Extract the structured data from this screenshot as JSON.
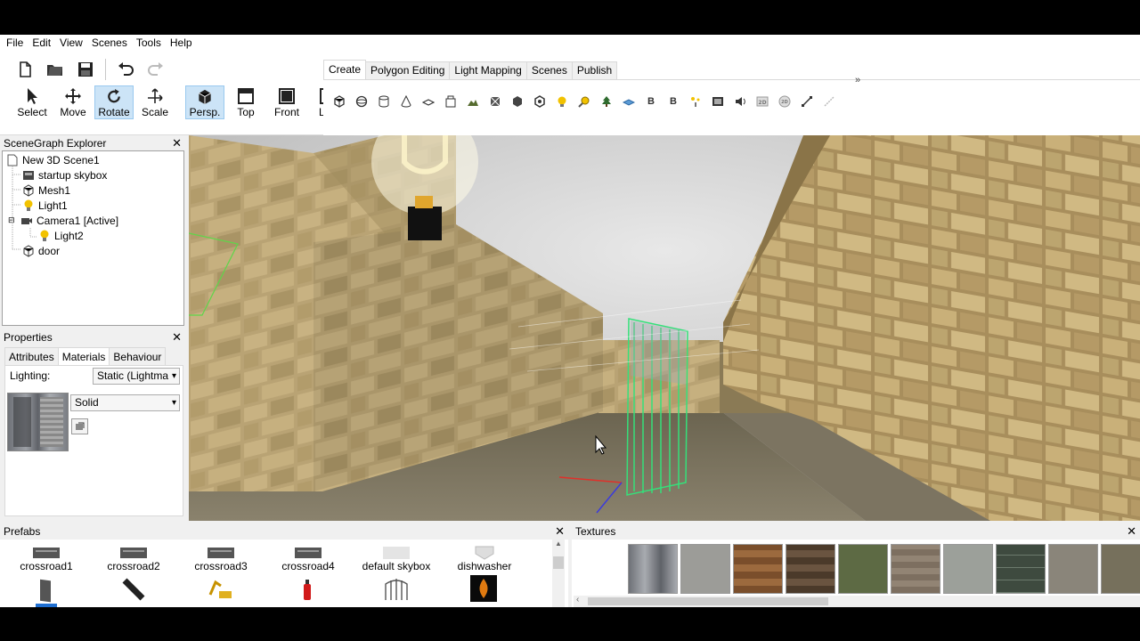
{
  "menu": [
    "File",
    "Edit",
    "View",
    "Scenes",
    "Tools",
    "Help"
  ],
  "toolbar": {
    "file_buttons": [
      "new-file-icon",
      "open-folder-icon",
      "save-icon",
      "undo-icon",
      "redo-icon"
    ],
    "tools": [
      {
        "id": "select",
        "label": "Select",
        "icon": "cursor-arrow-icon",
        "active": false
      },
      {
        "id": "move",
        "label": "Move",
        "icon": "move-arrows-icon",
        "active": false
      },
      {
        "id": "rotate",
        "label": "Rotate",
        "icon": "rotate-icon",
        "active": true
      },
      {
        "id": "scale",
        "label": "Scale",
        "icon": "scale-icon",
        "active": false
      }
    ],
    "views": [
      {
        "id": "persp",
        "label": "Persp.",
        "icon": "perspective-view-icon",
        "active": true
      },
      {
        "id": "top",
        "label": "Top",
        "icon": "top-view-icon",
        "active": false
      },
      {
        "id": "front",
        "label": "Front",
        "icon": "front-view-icon",
        "active": false
      },
      {
        "id": "left",
        "label": "Left",
        "icon": "left-view-icon",
        "active": false
      }
    ]
  },
  "ribbon": {
    "tabs": [
      "Create",
      "Polygon Editing",
      "Light Mapping",
      "Scenes",
      "Publish"
    ],
    "active_tab": "Create",
    "overflow": "»",
    "create_icons": [
      "cube-icon",
      "sphere-icon",
      "cylinder-icon",
      "cone-icon",
      "plane-icon",
      "building-icon",
      "terrain-icon",
      "billboard-icon",
      "mesh-icon",
      "prefab-icon",
      "light-icon",
      "path-icon",
      "tree-icon",
      "water-icon",
      "behaviour-b-icon",
      "behaviour-b2-icon",
      "particle-icon",
      "image-icon",
      "sound-icon",
      "2d-overlay-icon",
      "2d-button-icon",
      "line-icon",
      "path-line-icon"
    ]
  },
  "scenegraph": {
    "title": "SceneGraph Explorer",
    "items": [
      {
        "label": "New 3D Scene1",
        "icon": "document-icon"
      },
      {
        "label": "startup skybox",
        "icon": "skybox-icon"
      },
      {
        "label": "Mesh1",
        "icon": "mesh-icon"
      },
      {
        "label": "Light1",
        "icon": "light-bulb-icon"
      },
      {
        "label": "Camera1 [Active]",
        "icon": "camera-icon"
      },
      {
        "label": "Light2",
        "icon": "light-bulb-icon"
      },
      {
        "label": "door",
        "icon": "mesh-icon"
      }
    ]
  },
  "properties": {
    "title": "Properties",
    "tabs": [
      "Attributes",
      "Materials",
      "Behaviour"
    ],
    "active_tab": "Materials",
    "lighting_label": "Lighting:",
    "lighting_value": "Static (Lightma",
    "material_mode": "Solid"
  },
  "prefabs": {
    "title": "Prefabs",
    "row1": [
      "crossroad1",
      "crossroad2",
      "crossroad3",
      "crossroad4",
      "default skybox",
      "dishwasher"
    ]
  },
  "textures": {
    "title": "Textures",
    "colors": [
      "#8a8d92",
      "#9c9c98",
      "#8b5a34",
      "#5a4634",
      "#5d6a44",
      "#7d6f60",
      "#9ca09a",
      "#6b7a6c",
      "#8a857a",
      "#76705c"
    ]
  }
}
